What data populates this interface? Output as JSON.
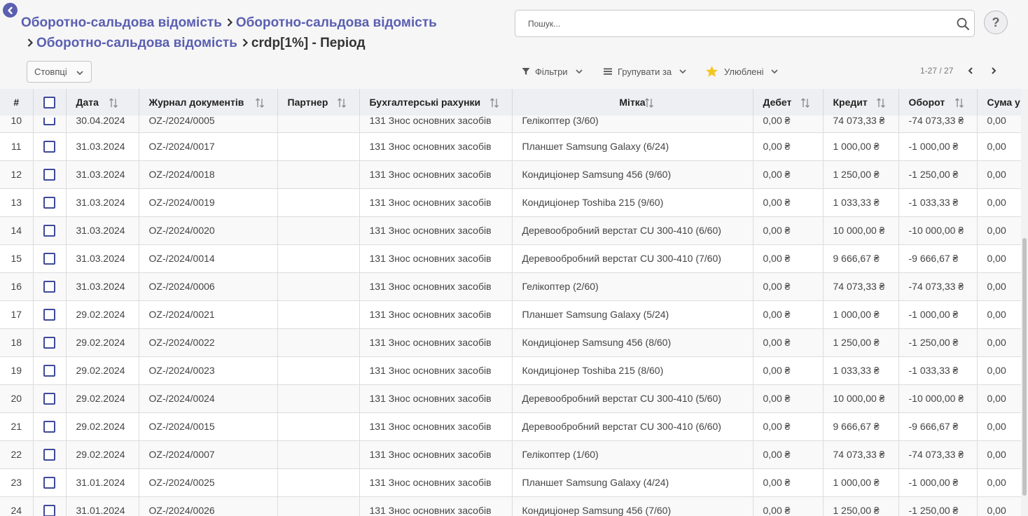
{
  "breadcrumb": {
    "link1": "Оборотно-сальдова відомість",
    "link2": "Оборотно-сальдова відомість",
    "link3": "Оборотно-сальдова відомість",
    "current": "crdp[1%] - Період"
  },
  "search": {
    "placeholder": "Пошук..."
  },
  "help": {
    "label": "?"
  },
  "toolbar": {
    "columns_label": "Стовпці",
    "filters_label": "Фільтри",
    "group_by_label": "Групувати за",
    "favorites_label": "Улюблені",
    "pager_text": "1-27 / 27"
  },
  "colors": {
    "accent": "#5a5fb0",
    "checkbox": "#3f4a9a",
    "favorite_star": "#f3c623"
  },
  "icons": {
    "back": "chevron-left-icon",
    "search": "search-icon",
    "filter": "filter-icon",
    "group_by": "list-icon",
    "favorites": "star-icon",
    "sort": "sort-icon"
  },
  "table": {
    "headers": {
      "num": "#",
      "date": "Дата",
      "journal": "Журнал документів",
      "partner": "Партнер",
      "accounts": "Бухгалтерські рахунки",
      "label": "Мітка",
      "debit": "Дебет",
      "credit": "Кредит",
      "turnover": "Оборот",
      "amount": "Сума у"
    },
    "rows": [
      {
        "num": "10",
        "date": "30.04.2024",
        "journal": "OZ-/2024/0005",
        "partner": "",
        "account": "131 Знос основних засобів",
        "label": "Гелікоптер (3/60)",
        "debit": "0,00 ₴",
        "credit": "74 073,33 ₴",
        "turnover": "-74 073,33 ₴",
        "amount": "0,00"
      },
      {
        "num": "11",
        "date": "31.03.2024",
        "journal": "OZ-/2024/0017",
        "partner": "",
        "account": "131 Знос основних засобів",
        "label": "Планшет Samsung Galaxy (6/24)",
        "debit": "0,00 ₴",
        "credit": "1 000,00 ₴",
        "turnover": "-1 000,00 ₴",
        "amount": "0,00"
      },
      {
        "num": "12",
        "date": "31.03.2024",
        "journal": "OZ-/2024/0018",
        "partner": "",
        "account": "131 Знос основних засобів",
        "label": "Кондиціонер Samsung 456 (9/60)",
        "debit": "0,00 ₴",
        "credit": "1 250,00 ₴",
        "turnover": "-1 250,00 ₴",
        "amount": "0,00"
      },
      {
        "num": "13",
        "date": "31.03.2024",
        "journal": "OZ-/2024/0019",
        "partner": "",
        "account": "131 Знос основних засобів",
        "label": "Кондиціонер Toshiba 215 (9/60)",
        "debit": "0,00 ₴",
        "credit": "1 033,33 ₴",
        "turnover": "-1 033,33 ₴",
        "amount": "0,00"
      },
      {
        "num": "14",
        "date": "31.03.2024",
        "journal": "OZ-/2024/0020",
        "partner": "",
        "account": "131 Знос основних засобів",
        "label": "Деревообробний верстат CU 300-410 (6/60)",
        "debit": "0,00 ₴",
        "credit": "10 000,00 ₴",
        "turnover": "-10 000,00 ₴",
        "amount": "0,00"
      },
      {
        "num": "15",
        "date": "31.03.2024",
        "journal": "OZ-/2024/0014",
        "partner": "",
        "account": "131 Знос основних засобів",
        "label": "Деревообробний верстат CU 300-410 (7/60)",
        "debit": "0,00 ₴",
        "credit": "9 666,67 ₴",
        "turnover": "-9 666,67 ₴",
        "amount": "0,00"
      },
      {
        "num": "16",
        "date": "31.03.2024",
        "journal": "OZ-/2024/0006",
        "partner": "",
        "account": "131 Знос основних засобів",
        "label": "Гелікоптер (2/60)",
        "debit": "0,00 ₴",
        "credit": "74 073,33 ₴",
        "turnover": "-74 073,33 ₴",
        "amount": "0,00"
      },
      {
        "num": "17",
        "date": "29.02.2024",
        "journal": "OZ-/2024/0021",
        "partner": "",
        "account": "131 Знос основних засобів",
        "label": "Планшет Samsung Galaxy (5/24)",
        "debit": "0,00 ₴",
        "credit": "1 000,00 ₴",
        "turnover": "-1 000,00 ₴",
        "amount": "0,00"
      },
      {
        "num": "18",
        "date": "29.02.2024",
        "journal": "OZ-/2024/0022",
        "partner": "",
        "account": "131 Знос основних засобів",
        "label": "Кондиціонер Samsung 456 (8/60)",
        "debit": "0,00 ₴",
        "credit": "1 250,00 ₴",
        "turnover": "-1 250,00 ₴",
        "amount": "0,00"
      },
      {
        "num": "19",
        "date": "29.02.2024",
        "journal": "OZ-/2024/0023",
        "partner": "",
        "account": "131 Знос основних засобів",
        "label": "Кондиціонер Toshiba 215 (8/60)",
        "debit": "0,00 ₴",
        "credit": "1 033,33 ₴",
        "turnover": "-1 033,33 ₴",
        "amount": "0,00"
      },
      {
        "num": "20",
        "date": "29.02.2024",
        "journal": "OZ-/2024/0024",
        "partner": "",
        "account": "131 Знос основних засобів",
        "label": "Деревообробний верстат CU 300-410 (5/60)",
        "debit": "0,00 ₴",
        "credit": "10 000,00 ₴",
        "turnover": "-10 000,00 ₴",
        "amount": "0,00"
      },
      {
        "num": "21",
        "date": "29.02.2024",
        "journal": "OZ-/2024/0015",
        "partner": "",
        "account": "131 Знос основних засобів",
        "label": "Деревообробний верстат CU 300-410 (6/60)",
        "debit": "0,00 ₴",
        "credit": "9 666,67 ₴",
        "turnover": "-9 666,67 ₴",
        "amount": "0,00"
      },
      {
        "num": "22",
        "date": "29.02.2024",
        "journal": "OZ-/2024/0007",
        "partner": "",
        "account": "131 Знос основних засобів",
        "label": "Гелікоптер (1/60)",
        "debit": "0,00 ₴",
        "credit": "74 073,33 ₴",
        "turnover": "-74 073,33 ₴",
        "amount": "0,00"
      },
      {
        "num": "23",
        "date": "31.01.2024",
        "journal": "OZ-/2024/0025",
        "partner": "",
        "account": "131 Знос основних засобів",
        "label": "Планшет Samsung Galaxy (4/24)",
        "debit": "0,00 ₴",
        "credit": "1 000,00 ₴",
        "turnover": "-1 000,00 ₴",
        "amount": "0,00"
      },
      {
        "num": "24",
        "date": "31.01.2024",
        "journal": "OZ-/2024/0026",
        "partner": "",
        "account": "131 Знос основних засобів",
        "label": "Кондиціонер Samsung 456 (7/60)",
        "debit": "0,00 ₴",
        "credit": "1 250,00 ₴",
        "turnover": "-1 250,00 ₴",
        "amount": "0,00"
      }
    ]
  }
}
